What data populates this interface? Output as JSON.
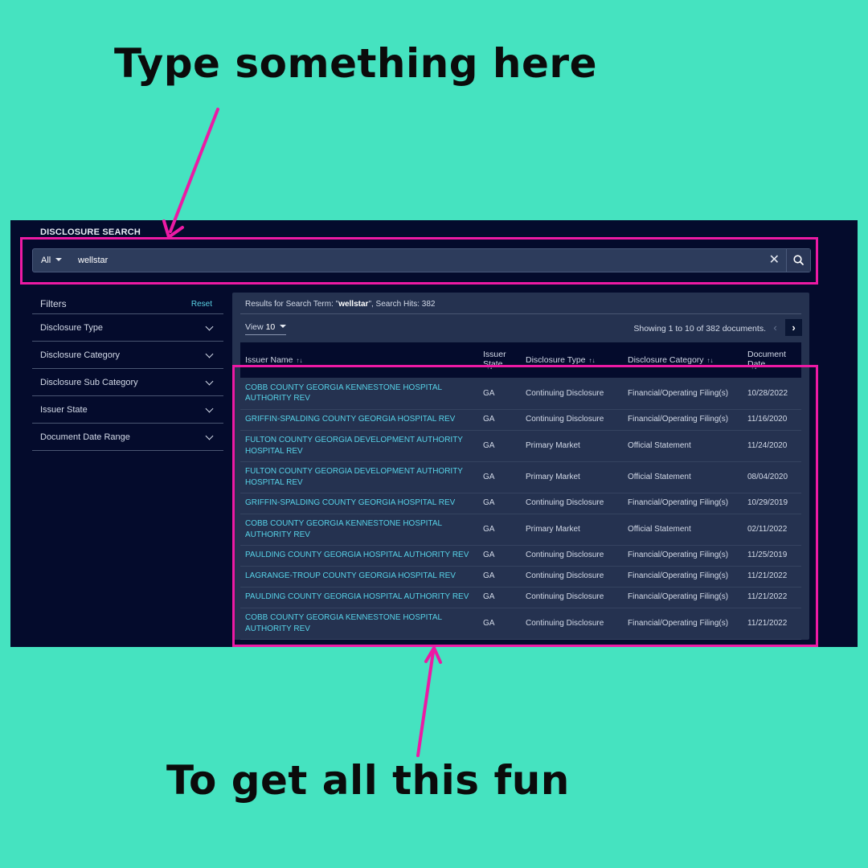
{
  "captions": {
    "top": "Type something here",
    "bottom": "To get all this fun"
  },
  "colors": {
    "background": "#45e3c0",
    "highlight": "#ec1aa4",
    "panel": "#040b2c",
    "link": "#57d3e8"
  },
  "app": {
    "title": "DISCLOSURE SEARCH"
  },
  "search": {
    "scope": "All",
    "value": "wellstar",
    "clear_icon": "close-icon",
    "submit_icon": "search-icon"
  },
  "filters": {
    "title": "Filters",
    "reset": "Reset",
    "items": [
      "Disclosure Type",
      "Disclosure Category",
      "Disclosure Sub Category",
      "Issuer State",
      "Document Date Range"
    ]
  },
  "results": {
    "term_prefix": "Results for Search Term: \"",
    "term": "wellstar",
    "term_suffix": "\", Search Hits: 382",
    "view_label": "View",
    "view_value": "10",
    "showing": "Showing 1 to 10 of 382 documents.",
    "columns": [
      {
        "line1": "Issuer Name",
        "line2": ""
      },
      {
        "line1": "Issuer",
        "line2": "State"
      },
      {
        "line1": "Disclosure Type",
        "line2": ""
      },
      {
        "line1": "Disclosure Category",
        "line2": ""
      },
      {
        "line1": "Document",
        "line2": "Date"
      }
    ],
    "rows": [
      [
        "COBB COUNTY GEORGIA KENNESTONE HOSPITAL AUTHORITY REV",
        "GA",
        "Continuing Disclosure",
        "Financial/Operating Filing(s)",
        "10/28/2022"
      ],
      [
        "GRIFFIN-SPALDING COUNTY GEORGIA HOSPITAL REV",
        "GA",
        "Continuing Disclosure",
        "Financial/Operating Filing(s)",
        "11/16/2020"
      ],
      [
        "FULTON COUNTY GEORGIA DEVELOPMENT AUTHORITY HOSPITAL REV",
        "GA",
        "Primary Market",
        "Official Statement",
        "11/24/2020"
      ],
      [
        "FULTON COUNTY GEORGIA DEVELOPMENT AUTHORITY HOSPITAL REV",
        "GA",
        "Primary Market",
        "Official Statement",
        "08/04/2020"
      ],
      [
        "GRIFFIN-SPALDING COUNTY GEORGIA HOSPITAL REV",
        "GA",
        "Continuing Disclosure",
        "Financial/Operating Filing(s)",
        "10/29/2019"
      ],
      [
        "COBB COUNTY GEORGIA KENNESTONE HOSPITAL AUTHORITY REV",
        "GA",
        "Primary Market",
        "Official Statement",
        "02/11/2022"
      ],
      [
        "PAULDING COUNTY GEORGIA HOSPITAL AUTHORITY REV",
        "GA",
        "Continuing Disclosure",
        "Financial/Operating Filing(s)",
        "11/25/2019"
      ],
      [
        "LAGRANGE-TROUP COUNTY GEORGIA HOSPITAL REV",
        "GA",
        "Continuing Disclosure",
        "Financial/Operating Filing(s)",
        "11/21/2022"
      ],
      [
        "PAULDING COUNTY GEORGIA HOSPITAL AUTHORITY REV",
        "GA",
        "Continuing Disclosure",
        "Financial/Operating Filing(s)",
        "11/21/2022"
      ],
      [
        "COBB COUNTY GEORGIA KENNESTONE HOSPITAL AUTHORITY REV",
        "GA",
        "Continuing Disclosure",
        "Financial/Operating Filing(s)",
        "11/21/2022"
      ]
    ]
  }
}
